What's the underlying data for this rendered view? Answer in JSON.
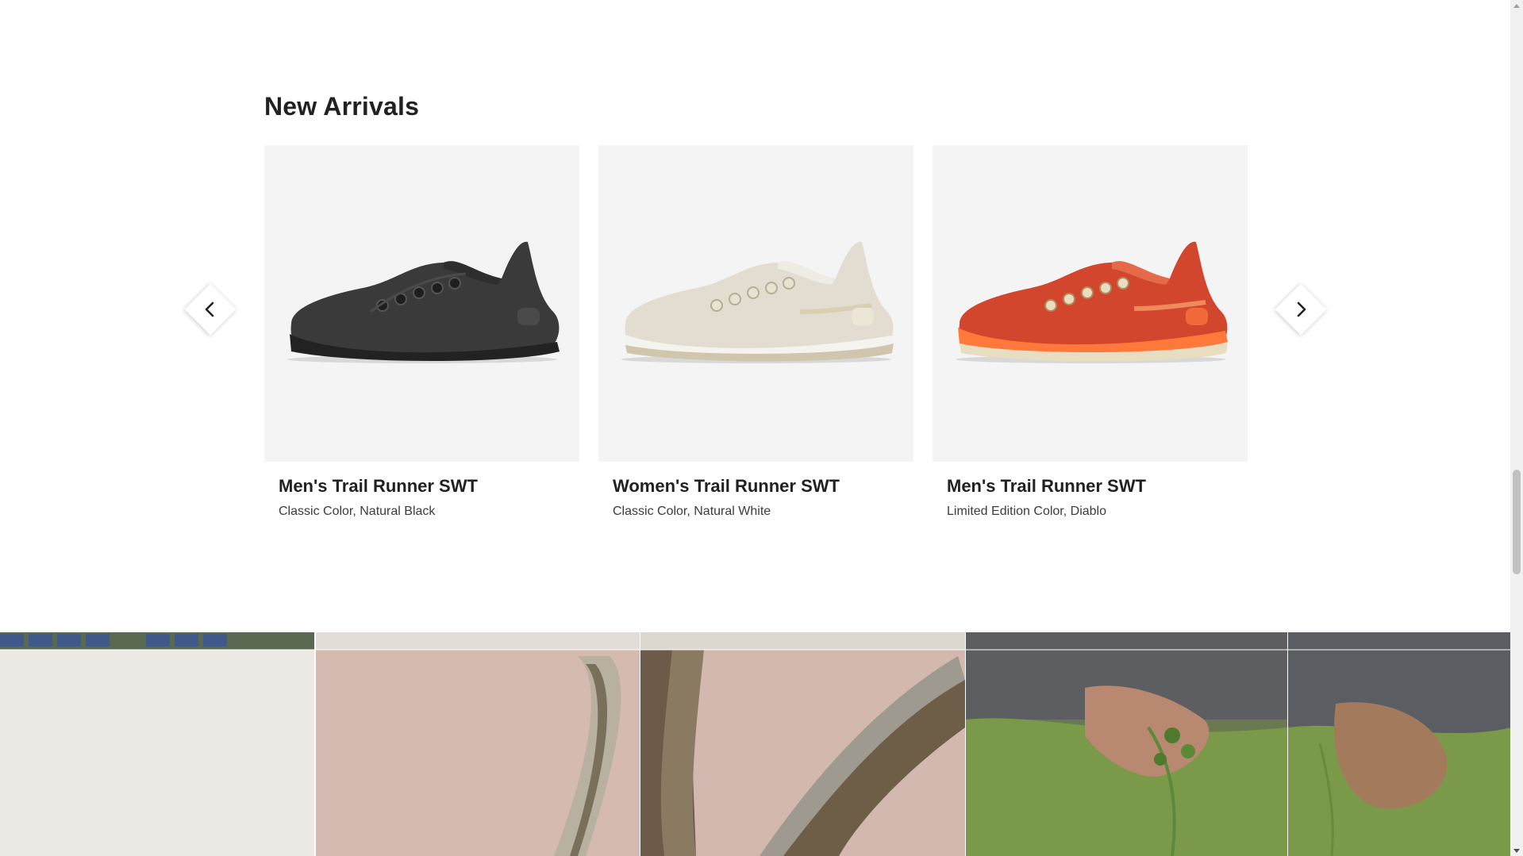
{
  "section": {
    "title": "New Arrivals"
  },
  "carousel": {
    "prev_icon": "chevron-left-icon",
    "next_icon": "chevron-right-icon",
    "products": [
      {
        "name": "Men's Trail Runner SWT",
        "description": "Classic Color, Natural Black",
        "colors": {
          "upper": "#3a3a3a",
          "sole": "#2a2a2a",
          "accent": "#4a4a4a"
        }
      },
      {
        "name": "Women's Trail Runner SWT",
        "description": "Classic Color, Natural White",
        "colors": {
          "upper": "#e2ddd0",
          "sole": "#f2f0ea",
          "accent": "#cfc6ad"
        }
      },
      {
        "name": "Men's Trail Runner SWT",
        "description": "Limited Edition Color, Diablo",
        "colors": {
          "upper": "#d1462c",
          "sole": "#ff7a3a",
          "accent": "#e8ddc0"
        }
      }
    ]
  },
  "theme": {
    "card_bg": "#f4f4f4",
    "text": "#212121"
  }
}
